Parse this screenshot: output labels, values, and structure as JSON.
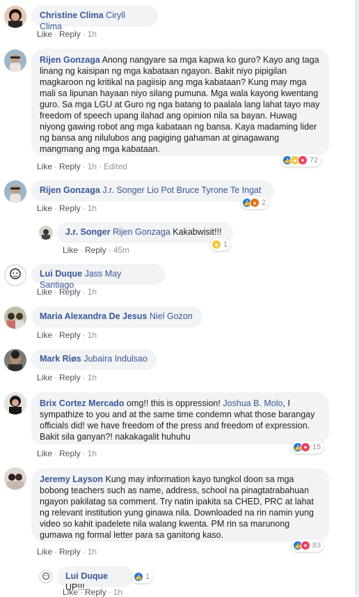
{
  "actions": {
    "like": "Like",
    "reply": "Reply",
    "sep": "·"
  },
  "colors": {
    "name": "#385898",
    "bubble": "#f2f3f5",
    "meta": "#90949c"
  },
  "comments": [
    {
      "author": "Christine Clima",
      "tag": "Ciryll Clima",
      "text": "",
      "time": "1h",
      "edited": "",
      "reactions": null
    },
    {
      "author": "Rijen Gonzaga",
      "tag": "",
      "text": "Anong nangyare sa mga kapwa ko guro? Kayo ang taga linang ng kaisipan ng mga kabataan ngayon. Bakit niyo pipigilan magkaroon ng kritikal na pagiisip ang mga kabataan? Kung may mga mali sa lipunan hayaan niyo silang pumuna. Mga wala kayong kwentang guro. Sa mga LGU at Guro ng nga batang to paalala lang lahat tayo may freedom of speech upang ilahad ang opinion nila sa bayan. Huwag niyong gawing robot ang mga kabataan ng bansa. Kaya madaming lider ng bansa ang nilulubos ang pagiging gahaman at ginagawang mangmang ang mga kabataan.",
      "time": "1h",
      "edited": "Edited",
      "reactions": {
        "icons": [
          "like-icon",
          "sad-icon",
          "love-icon"
        ],
        "count": "72"
      }
    },
    {
      "author": "Rijen Gonzaga",
      "tag": "J.r. Songer Lio Pot Bruce Tyrone Te Ingat",
      "text": "",
      "time": "1h",
      "edited": "",
      "reactions": {
        "icons": [
          "like-icon",
          "angry-icon"
        ],
        "count": "2"
      }
    },
    {
      "author": "J.r. Songer",
      "tag": "Rijen Gonzaga",
      "text": "Kakabwisit!!!",
      "time": "45m",
      "edited": "",
      "reactions": {
        "icons": [
          "sad-icon"
        ],
        "count": "1"
      }
    },
    {
      "author": "Lui Duque",
      "tag": "Jass May Santiago",
      "text": "",
      "time": "1h",
      "edited": "",
      "reactions": null
    },
    {
      "author": "Maria Alexandra De Jesus",
      "tag": "Niel Gozon",
      "text": "",
      "time": "1h",
      "edited": "",
      "reactions": null
    },
    {
      "author": "Mark Riøs",
      "tag": "Jubaira Indulsao",
      "text": "",
      "time": "1h",
      "edited": "",
      "reactions": null
    },
    {
      "author": "Brix Cortez Mercado",
      "tag": "",
      "text": "omg!! this is oppression!",
      "tag2": "Joshua B. Molo",
      "text2": ", I sympathize to you and at the same time condemn what those barangay officials did! we have freedom of the press and freedom of expression. Bakit sila ganyan?! nakakagalit huhuhu",
      "time": "1h",
      "edited": "",
      "reactions": {
        "icons": [
          "like-icon",
          "love-icon"
        ],
        "count": "15"
      }
    },
    {
      "author": "Jeremy Layson",
      "tag": "",
      "text": "Kung may information kayo tungkol doon sa mga bobong teachers such as name, address, school na pinagtatrabahuan ngayon pakilatag sa comment. Try natin ipakita sa CHED, PRC at lahat ng relevant institution yung ginawa nila. Downloaded na rin namin yung video so kahit ipadelete nila walang kwenta. PM rin sa marunong gumawa ng formal letter para sa ganitong kaso.",
      "time": "1h",
      "edited": "",
      "reactions": {
        "icons": [
          "like-icon",
          "love-icon"
        ],
        "count": "83"
      }
    },
    {
      "author": "Lui Duque",
      "tag": "",
      "text": "UP!!!",
      "time": "1h",
      "edited": "",
      "reactions": {
        "icons": [
          "like-icon"
        ],
        "count": "1"
      }
    }
  ]
}
